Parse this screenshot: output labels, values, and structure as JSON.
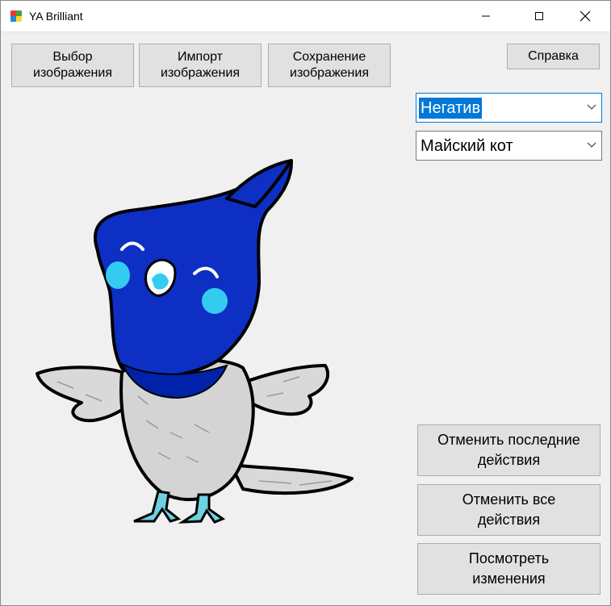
{
  "window": {
    "title": "YA Brilliant"
  },
  "toolbar": {
    "select_image": "Выбор\nизображения",
    "import_image": "Импорт\nизображения",
    "save_image": "Сохранение\nизображения",
    "help": "Справка"
  },
  "filters": {
    "selected": "Негатив"
  },
  "styles": {
    "selected": "Майский кот"
  },
  "actions": {
    "undo_last": "Отменить последние\nдействия",
    "undo_all": "Отменить все\nдействия",
    "view_changes": "Посмотреть\nизменения"
  },
  "colors": {
    "accent": "#0078d7",
    "bird_blue": "#0d2fc4",
    "bird_cheek": "#33ccf0",
    "bird_body": "#d8d8d8"
  }
}
